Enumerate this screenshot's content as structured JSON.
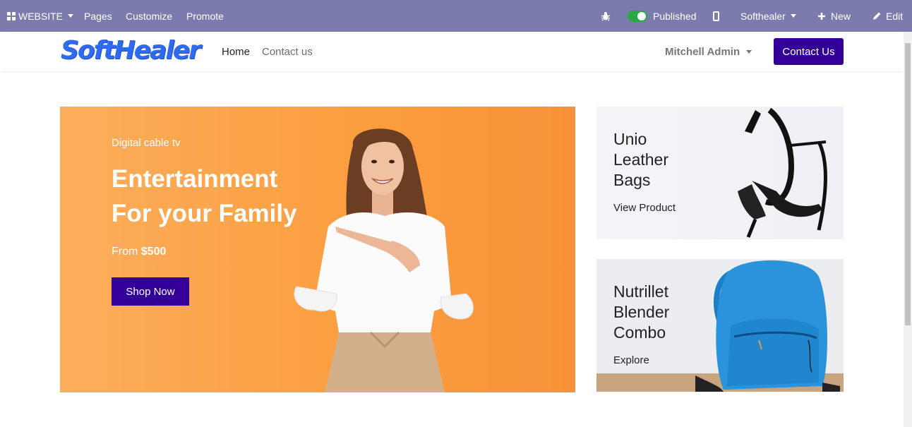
{
  "adminbar": {
    "website_label": "WEBSITE",
    "pages_label": "Pages",
    "customize_label": "Customize",
    "promote_label": "Promote",
    "published_label": "Published",
    "company_label": "Softhealer",
    "new_label": "New",
    "edit_label": "Edit",
    "icons": [
      "grid-icon",
      "bug-icon",
      "toggle-icon",
      "mobile-icon",
      "plus-icon",
      "pencil-icon"
    ]
  },
  "header": {
    "logo_text": "SoftHealer",
    "nav": [
      {
        "label": "Home",
        "active": true
      },
      {
        "label": "Contact us",
        "active": false
      }
    ],
    "user_name": "Mitchell Admin",
    "contact_button": "Contact Us"
  },
  "hero": {
    "subtitle": "Digital cable tv",
    "title_line1": "Entertainment",
    "title_line2": "For your Family",
    "price_prefix": "From",
    "price_value": "$500",
    "button_label": "Shop Now"
  },
  "cards": [
    {
      "title": "Unio Leather Bags",
      "link": "View Product",
      "image": "black-heels-image"
    },
    {
      "title": "Nutrillet Blender Combo",
      "link": "Explore",
      "image": "blue-backpack-image"
    }
  ],
  "colors": {
    "adminbar_bg": "#7c7bad",
    "brand_button": "#330099",
    "hero_bg": "#fb9d3e",
    "logo": "#2e6bf0",
    "toggle_on": "#28a745"
  }
}
